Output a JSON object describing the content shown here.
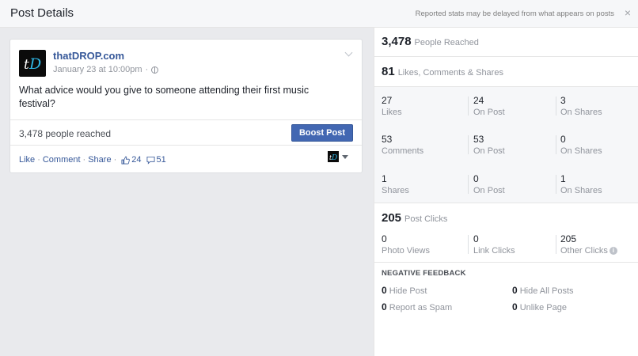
{
  "header": {
    "title": "Post Details",
    "note": "Reported stats may be delayed from what appears on posts",
    "close": "×"
  },
  "post": {
    "page_name": "thatDROP.com",
    "timestamp": "January 23 at 10:00pm",
    "meta_sep": "·",
    "text": "What advice would you give to someone attending their first music festival?",
    "reach_text": "3,478 people reached",
    "boost_label": "Boost Post",
    "actions": {
      "like": "Like",
      "comment": "Comment",
      "share": "Share",
      "sep": "·",
      "likes_count": "24",
      "comments_count": "51"
    }
  },
  "stats": {
    "reached": {
      "value": "3,478",
      "label": "People Reached"
    },
    "engagement": {
      "value": "81",
      "label": "Likes, Comments & Shares"
    },
    "likes_row": [
      {
        "value": "27",
        "label": "Likes"
      },
      {
        "value": "24",
        "label": "On Post"
      },
      {
        "value": "3",
        "label": "On Shares"
      }
    ],
    "comments_row": [
      {
        "value": "53",
        "label": "Comments"
      },
      {
        "value": "53",
        "label": "On Post"
      },
      {
        "value": "0",
        "label": "On Shares"
      }
    ],
    "shares_row": [
      {
        "value": "1",
        "label": "Shares"
      },
      {
        "value": "0",
        "label": "On Post"
      },
      {
        "value": "1",
        "label": "On Shares"
      }
    ],
    "clicks": {
      "value": "205",
      "label": "Post Clicks"
    },
    "clicks_row": [
      {
        "value": "0",
        "label": "Photo Views"
      },
      {
        "value": "0",
        "label": "Link Clicks"
      },
      {
        "value": "205",
        "label": "Other Clicks"
      }
    ],
    "negative": {
      "title": "NEGATIVE FEEDBACK",
      "items": [
        {
          "value": "0",
          "label": "Hide Post"
        },
        {
          "value": "0",
          "label": "Hide All Posts"
        },
        {
          "value": "0",
          "label": "Report as Spam"
        },
        {
          "value": "0",
          "label": "Unlike Page"
        }
      ]
    }
  },
  "colors": {
    "brand_blue": "#365899",
    "button_blue": "#4267b2",
    "panel_gray": "#f6f7f9",
    "avatar_accent": "#2fb7e6"
  }
}
